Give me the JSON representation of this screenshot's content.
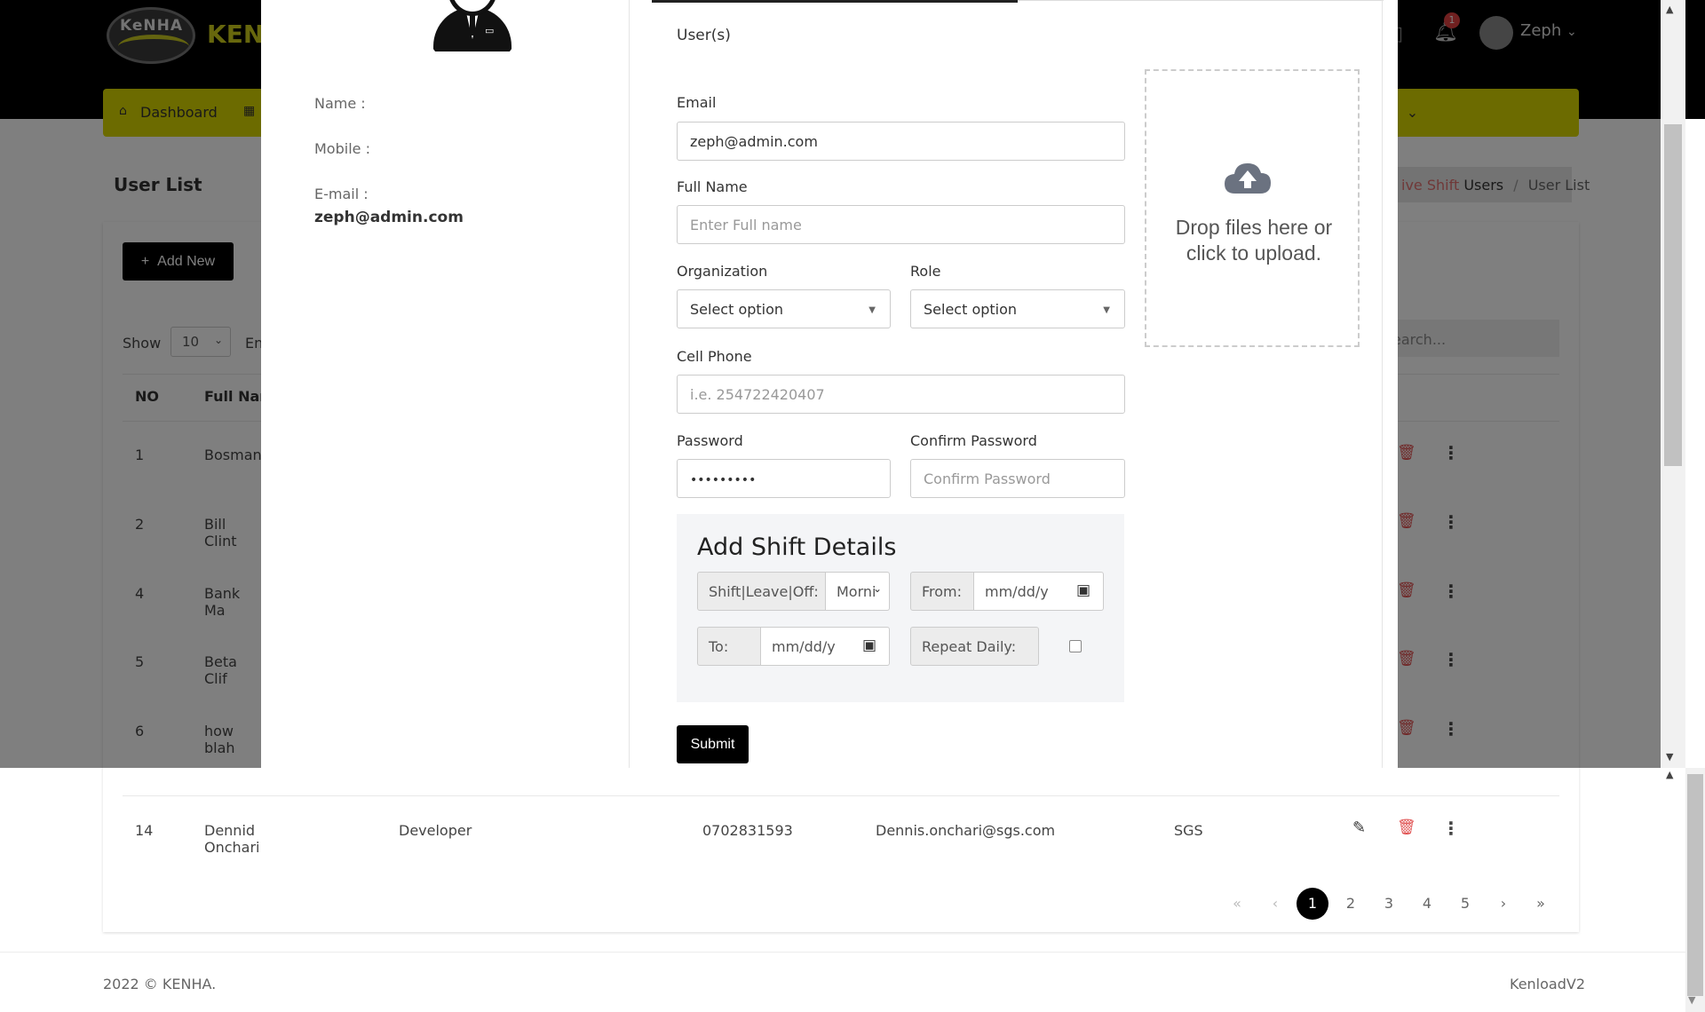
{
  "app": {
    "logo_text": "KeNHA",
    "brand_text": "KENL",
    "notification_count": "1",
    "user_name": "Zeph",
    "user_caret": "⌄"
  },
  "nav": {
    "dashboard_label": "Dashboard",
    "last_chevron": "⌄"
  },
  "page": {
    "title": "User List",
    "breadcrumb": [
      {
        "label": "ive Shift",
        "color": "#e07070"
      },
      {
        "label": "Users",
        "color": "#333333"
      },
      {
        "label": "/",
        "color": "#999999"
      },
      {
        "label": "User List",
        "color": "#666666"
      }
    ],
    "add_new_label": "Add New",
    "show_label": "Show",
    "show_value": "10",
    "entries_label": "En",
    "search_placeholder": "earch..."
  },
  "table": {
    "headers": [
      "NO",
      "Full Nam"
    ],
    "rows": [
      {
        "no": "1",
        "name": "Bosman"
      },
      {
        "no": "2",
        "name": "Bill Clint"
      },
      {
        "no": "4",
        "name": "Bank Ma"
      },
      {
        "no": "5",
        "name": "Beta Clif"
      },
      {
        "no": "6",
        "name": "how blah"
      }
    ],
    "last_row": {
      "no": "14",
      "name": "Dennid Onchari",
      "role": "Developer",
      "phone": "0702831593",
      "email": "Dennis.onchari@sgs.com",
      "org": "SGS"
    }
  },
  "pagination": {
    "first": "«",
    "prev": "‹",
    "pages": [
      "1",
      "2",
      "3",
      "4",
      "5"
    ],
    "active": "1",
    "next": "›",
    "last": "»"
  },
  "footer": {
    "copyright": "2022 © KENHA.",
    "version": "KenloadV2"
  },
  "modal": {
    "profile": {
      "name_label": "Name :",
      "mobile_label": "Mobile :",
      "email_label": "E-mail :",
      "email_value": "zeph@admin.com"
    },
    "section_title": "User(s)",
    "form": {
      "email_label": "Email",
      "email_value": "zeph@admin.com",
      "fullname_label": "Full Name",
      "fullname_placeholder": "Enter Full name",
      "org_label": "Organization",
      "org_value": "Select option",
      "role_label": "Role",
      "role_value": "Select option",
      "phone_label": "Cell Phone",
      "phone_placeholder": "i.e. 254722420407",
      "password_label": "Password",
      "password_value": "•••••••••",
      "confirm_label": "Confirm Password",
      "confirm_placeholder": "Confirm Password"
    },
    "dropzone_text": "Drop files here or click to upload.",
    "shift": {
      "title": "Add Shift Details",
      "type_label": "Shift|Leave|Off:",
      "type_value": "Morni",
      "from_label": "From:",
      "from_value": "mm/dd/y",
      "to_label": "To:",
      "to_value": "mm/dd/y",
      "repeat_label": "Repeat Daily:"
    },
    "submit_label": "Submit"
  },
  "colors": {
    "nav_bar": "#d8d600",
    "brand_yellow": "#cfcf1a",
    "danger": "#e05050",
    "primary_button": "#000000"
  }
}
